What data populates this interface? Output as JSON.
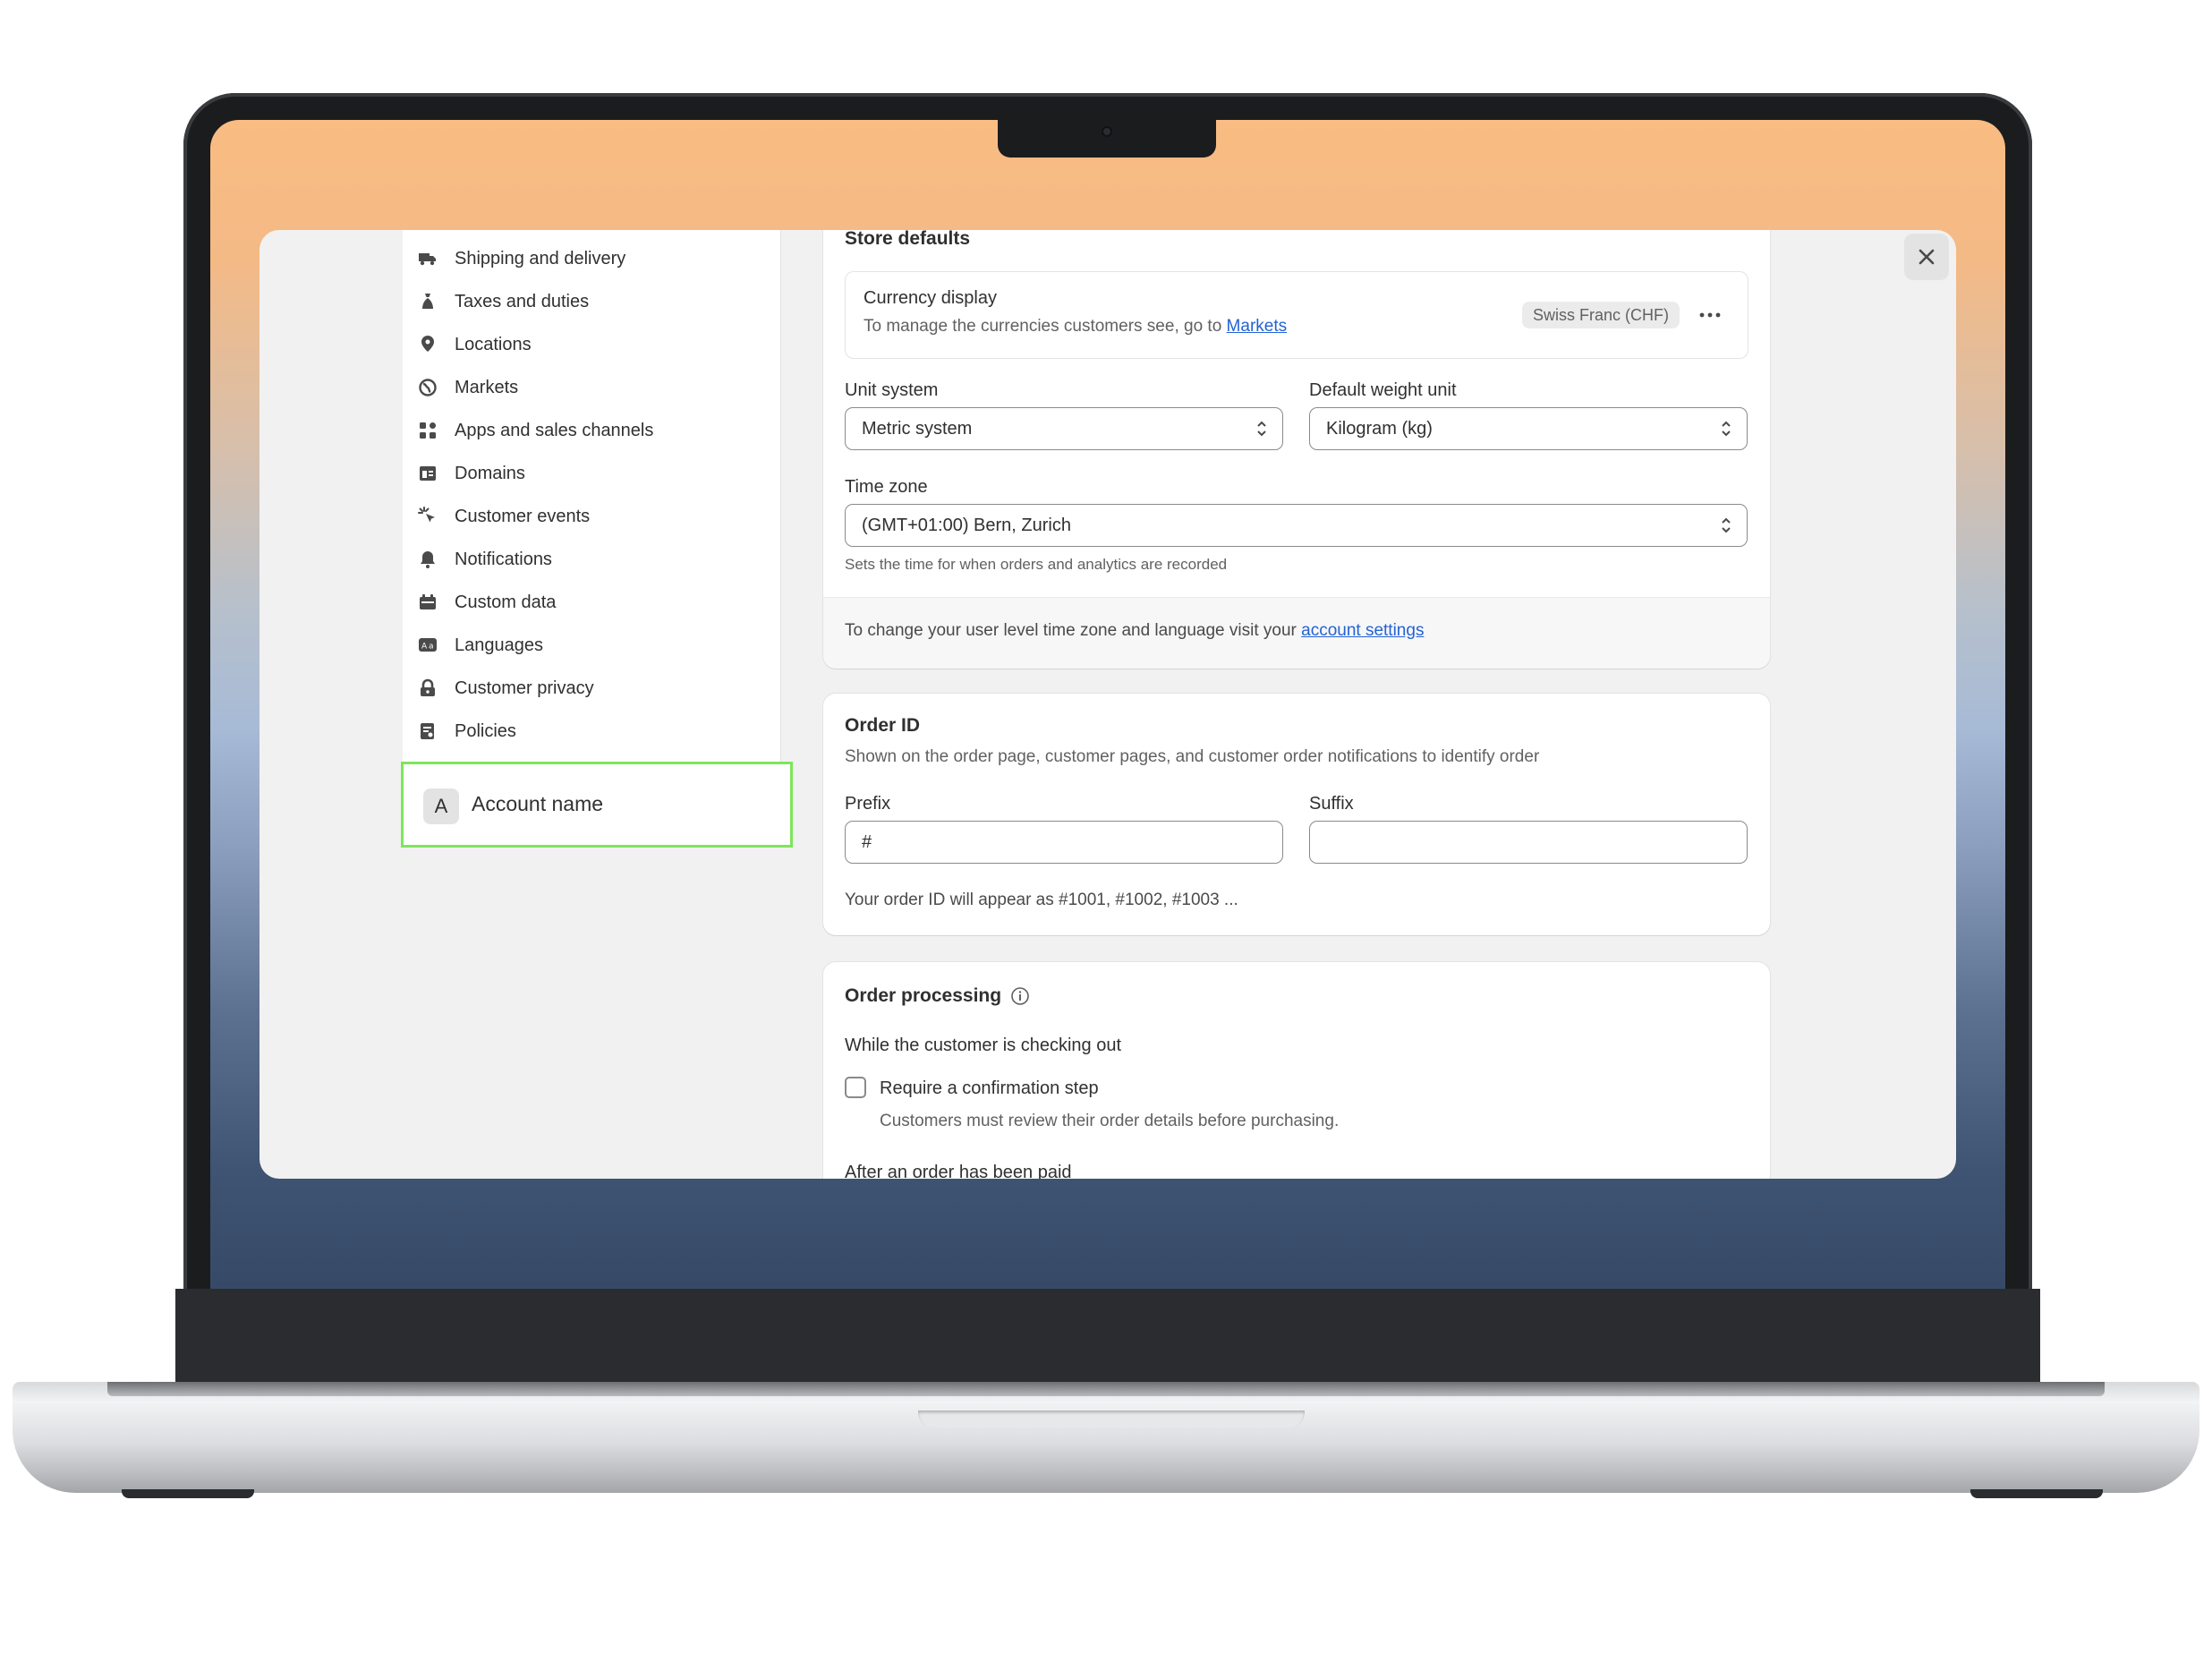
{
  "colors": {
    "accent_link": "#2463d3",
    "highlight_border": "#7de65a",
    "window_bg": "#f1f1f1"
  },
  "sidebar": {
    "items": [
      {
        "label": "Shipping and delivery",
        "icon": "truck-icon"
      },
      {
        "label": "Taxes and duties",
        "icon": "tax-bag-icon"
      },
      {
        "label": "Locations",
        "icon": "location-pin-icon"
      },
      {
        "label": "Markets",
        "icon": "globe-icon"
      },
      {
        "label": "Apps and sales channels",
        "icon": "apps-icon"
      },
      {
        "label": "Domains",
        "icon": "domain-icon"
      },
      {
        "label": "Customer events",
        "icon": "cursor-click-icon"
      },
      {
        "label": "Notifications",
        "icon": "bell-icon"
      },
      {
        "label": "Custom data",
        "icon": "calendar-data-icon"
      },
      {
        "label": "Languages",
        "icon": "translate-icon"
      },
      {
        "label": "Customer privacy",
        "icon": "lock-icon"
      },
      {
        "label": "Policies",
        "icon": "policy-icon"
      }
    ],
    "account": {
      "avatar_letter": "A",
      "label": "Account name"
    }
  },
  "store_defaults": {
    "title": "Store defaults",
    "currency": {
      "title": "Currency display",
      "description": "To manage the currencies customers see, go to",
      "link": "Markets",
      "badge": "Swiss Franc (CHF)"
    },
    "unit_system": {
      "label": "Unit system",
      "value": "Metric system"
    },
    "weight_unit": {
      "label": "Default weight unit",
      "value": "Kilogram (kg)"
    },
    "time_zone": {
      "label": "Time zone",
      "value": "(GMT+01:00) Bern, Zurich",
      "help": "Sets the time for when orders and analytics are recorded"
    },
    "footer": {
      "text": "To change your user level time zone and language visit your",
      "link": "account settings"
    }
  },
  "order_id": {
    "title": "Order ID",
    "description": "Shown on the order page, customer pages, and customer order notifications to identify order",
    "prefix": {
      "label": "Prefix",
      "value": "#"
    },
    "suffix": {
      "label": "Suffix",
      "value": ""
    },
    "preview": "Your order ID will appear as #1001, #1002, #1003 ..."
  },
  "order_processing": {
    "title": "Order processing",
    "checkout_heading": "While the customer is checking out",
    "confirm_label": "Require a confirmation step",
    "confirm_help": "Customers must review their order details before purchasing.",
    "after_paid_heading": "After an order has been paid"
  }
}
